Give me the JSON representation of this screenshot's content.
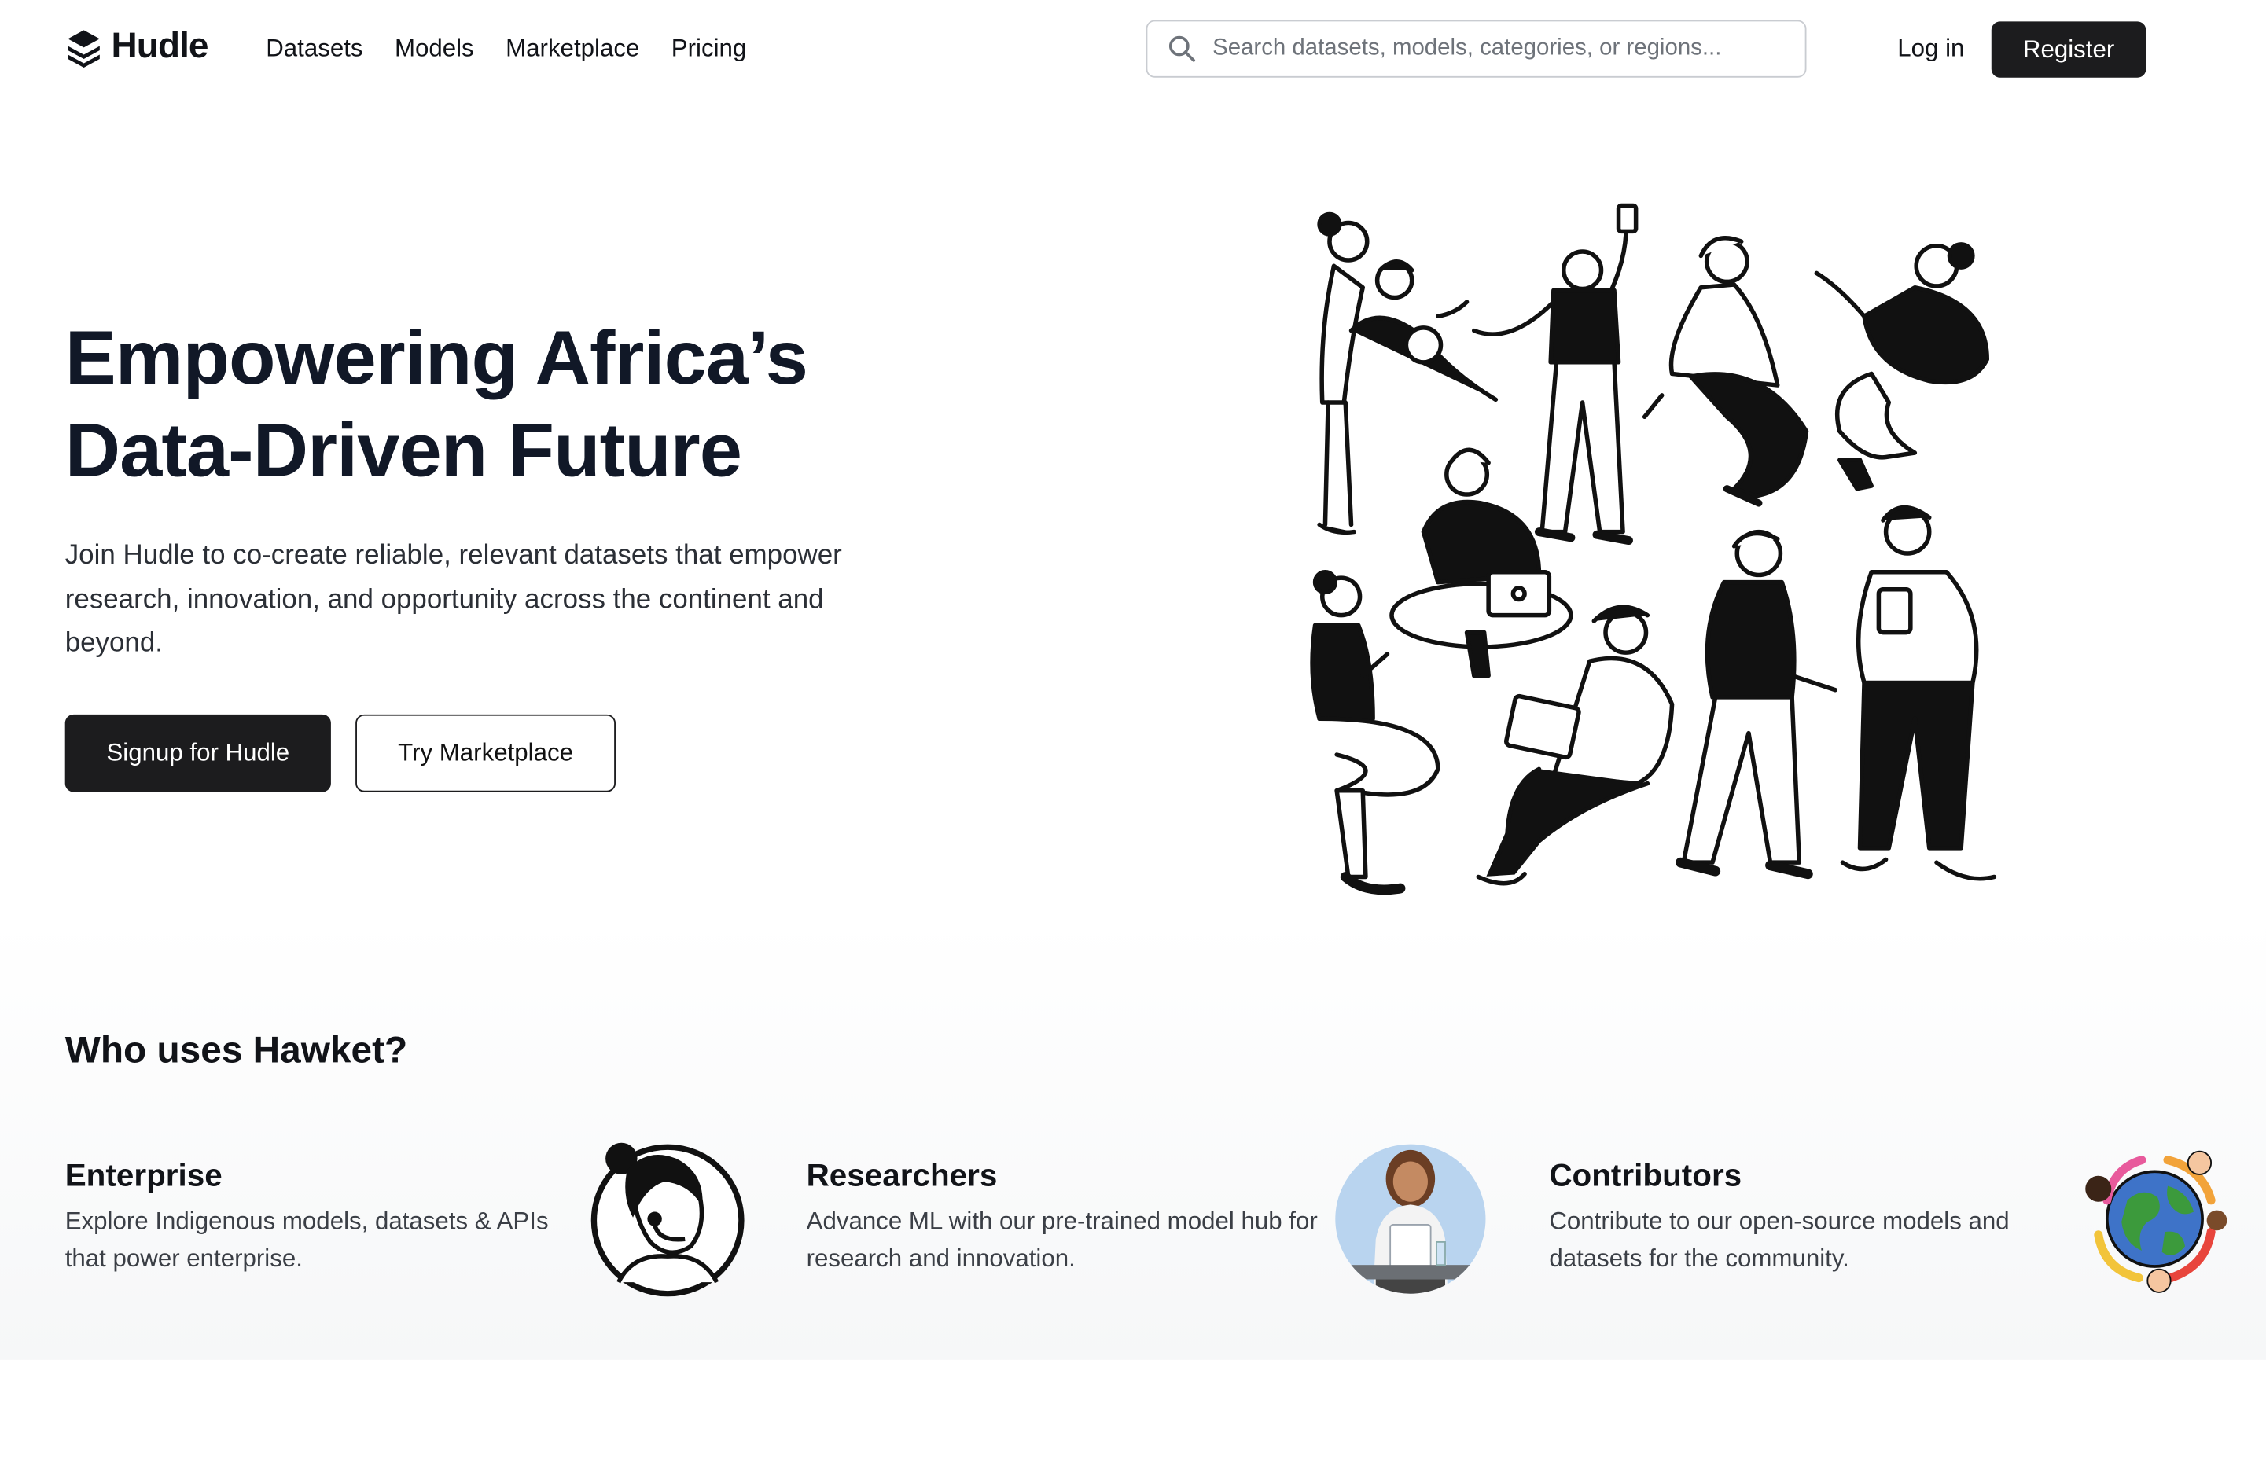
{
  "brand": {
    "name": "Hudle"
  },
  "nav": {
    "links": [
      "Datasets",
      "Models",
      "Marketplace",
      "Pricing"
    ],
    "search_placeholder": "Search datasets, models, categories, or regions...",
    "login_label": "Log in",
    "register_label": "Register"
  },
  "hero": {
    "title_line1": "Empowering Africa’s",
    "title_line2": "Data-Driven Future",
    "subtitle": "Join Hudle to co-create reliable, relevant datasets that empower research, innovation, and opportunity across the continent and beyond.",
    "primary_button": "Signup for Hudle",
    "secondary_button": "Try Marketplace"
  },
  "who": {
    "title": "Who uses Hawket?",
    "cards": [
      {
        "title": "Enterprise",
        "description": "Explore Indigenous models, datasets & APIs that power enterprise.",
        "icon": "headset-agent-icon"
      },
      {
        "title": "Researchers",
        "description": "Advance ML with our pre-trained model hub for research and innovation.",
        "icon": "researcher-avatar"
      },
      {
        "title": "Contributors",
        "description": "Contribute to our open-source models and datasets for the community.",
        "icon": "globe-community-icon"
      }
    ]
  },
  "colors": {
    "primary": "#1c1c1e",
    "text": "#111827",
    "muted": "#3b3f46",
    "border": "#c9ccd1"
  }
}
